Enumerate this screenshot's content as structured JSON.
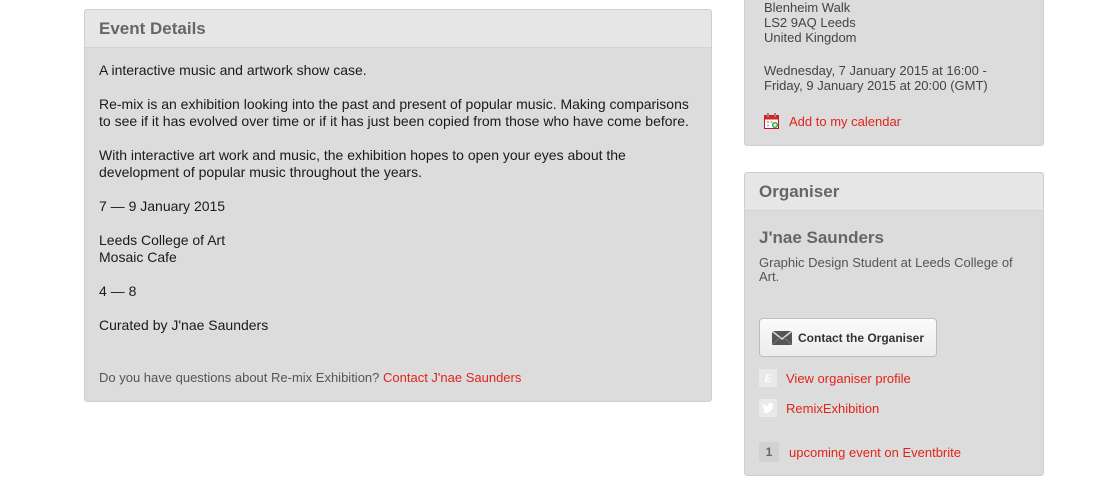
{
  "event_details": {
    "title": "Event Details",
    "paragraphs": [
      "A interactive music and artwork show case.",
      "Re-mix is an exhibition looking into the past and present of popular music. Making comparisons to see if it has evolved over time or if it has just been copied from those who have come before.",
      "With interactive art work and music, the exhibition hopes to open your eyes about the development of popular music throughout the years.",
      "7 — 9 January 2015",
      "Leeds College of Art\nMosaic Cafe",
      "4 — 8",
      "Curated by J'nae Saunders"
    ],
    "question_text": "Do you have questions about Re-mix Exhibition?",
    "contact_link": "Contact J'nae Saunders"
  },
  "location": {
    "address_lines": [
      "Blenheim Walk",
      "LS2 9AQ Leeds",
      "United Kingdom"
    ],
    "date_line_1": "Wednesday, 7 January 2015 at 16:00 -",
    "date_line_2": "Friday, 9 January 2015 at 20:00 (GMT)",
    "calendar_link": "Add to my calendar",
    "calendar_icon": "calendar-icon"
  },
  "organiser": {
    "title": "Organiser",
    "name": "J'nae Saunders",
    "description": "Graphic Design Student at Leeds College of Art.",
    "contact_button": "Contact the Organiser",
    "profile_link": "View organiser profile",
    "twitter_link": "RemixExhibition",
    "upcoming_count": "1",
    "upcoming_text": "upcoming event on Eventbrite"
  },
  "colors": {
    "link_red": "#e2231a",
    "panel_bg": "#dcdcdc",
    "header_bg": "#e6e6e6"
  }
}
